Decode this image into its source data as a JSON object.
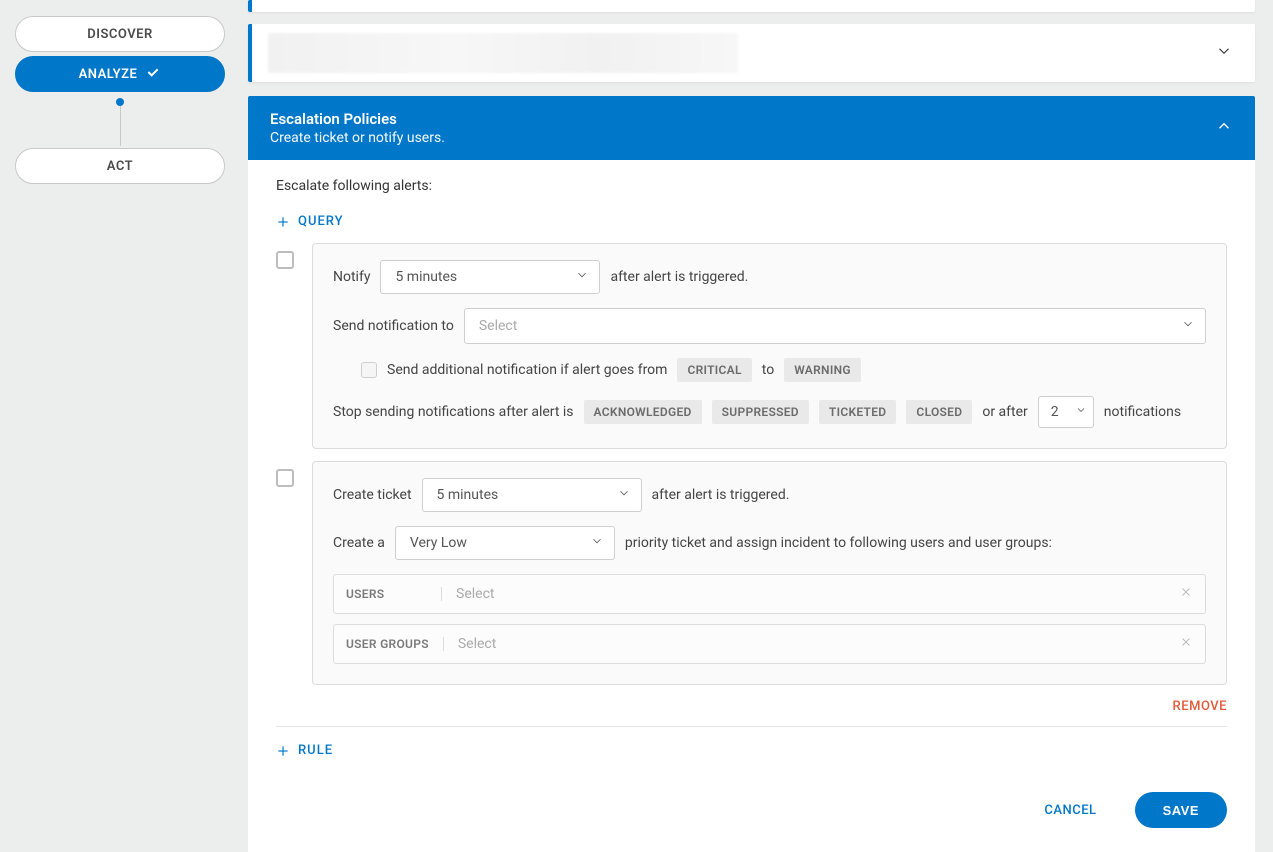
{
  "sidebar": {
    "discover": "DISCOVER",
    "analyze": "ANALYZE",
    "act": "ACT"
  },
  "panel": {
    "title": "Escalation Policies",
    "subtitle": "Create ticket or notify users.",
    "intro": "Escalate following alerts:"
  },
  "links": {
    "query": "QUERY",
    "rule": "RULE",
    "remove": "REMOVE"
  },
  "notify": {
    "label": "Notify",
    "delay_value": "5 minutes",
    "after_text": "after alert is triggered.",
    "send_to_label": "Send notification to",
    "send_to_placeholder": "Select",
    "additional_text": "Send additional notification if alert goes from",
    "to_text": "to",
    "tag_critical": "Critical",
    "tag_warning": "Warning",
    "stop_text_prefix": "Stop sending notifications after alert is",
    "tag_ack": "Acknowledged",
    "tag_supp": "Suppressed",
    "tag_tick": "Ticketed",
    "tag_closed": "Closed",
    "or_after": "or after",
    "count_value": "2",
    "notifications_suffix": "notifications"
  },
  "ticket": {
    "create_label": "Create ticket",
    "delay_value": "5 minutes",
    "after_text": "after alert is triggered.",
    "create_a": "Create a",
    "priority_value": "Very Low",
    "assign_text": "priority ticket and assign incident to following users and user groups:",
    "users_label": "USERS",
    "groups_label": "USER GROUPS",
    "select_placeholder": "Select"
  },
  "footer": {
    "cancel": "CANCEL",
    "save": "SAVE"
  }
}
